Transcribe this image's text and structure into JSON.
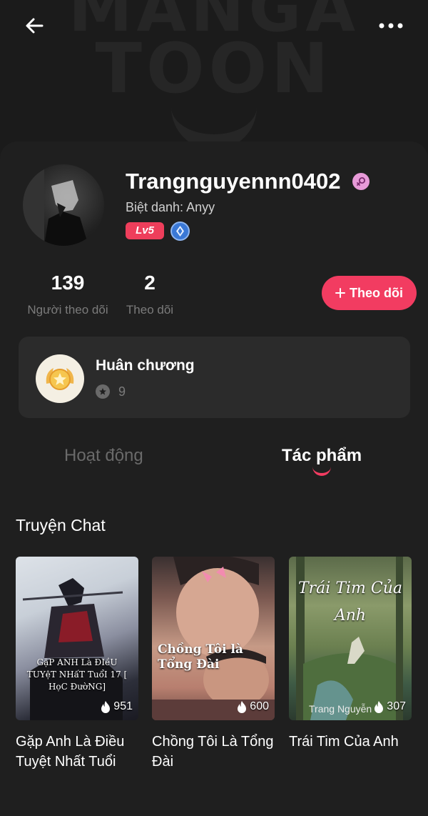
{
  "profile": {
    "username": "Trangnguyennn0402",
    "nickname": "Biệt danh: Anyy",
    "level": "Lv5"
  },
  "stats": {
    "followers_count": "139",
    "followers_label": "Người theo dõi",
    "following_count": "2",
    "following_label": "Theo dõi"
  },
  "follow_button": {
    "label": "Theo dõi"
  },
  "medals": {
    "title": "Huân chương",
    "count": "9"
  },
  "tabs": [
    {
      "label": "Hoạt động",
      "active": false
    },
    {
      "label": "Tác phẩm",
      "active": true
    }
  ],
  "section": {
    "title": "Truyện Chat"
  },
  "books": [
    {
      "title": "Gặp Anh Là Điều Tuyệt Nhất Tuổi",
      "views": "951",
      "cover_text": "GặP ANH Là ĐIềU TUYệT NHấT TuổI 17 [ HọC ĐườNG]"
    },
    {
      "title": "Chồng Tôi Là Tổng Đài",
      "views": "600",
      "cover_text": "Chồng Tôi là Tổng Đài"
    },
    {
      "title": "Trái Tim Của Anh",
      "views": "307",
      "cover_text": "Trái Tim Của Anh",
      "cover_author": "Trang Nguyễn"
    }
  ],
  "banner_text": [
    "MANGA",
    "TOON"
  ],
  "colors": {
    "accent": "#f23c61",
    "background": "#1f1f1f",
    "card": "#2b2b2b",
    "level_badge": "#ee3e5b",
    "gender_badge": "#e79ad8"
  },
  "icons": [
    "back-arrow-icon",
    "more-icon",
    "female-icon",
    "author-badge-icon",
    "plus-icon",
    "medal-icon",
    "star-icon",
    "fire-icon"
  ]
}
